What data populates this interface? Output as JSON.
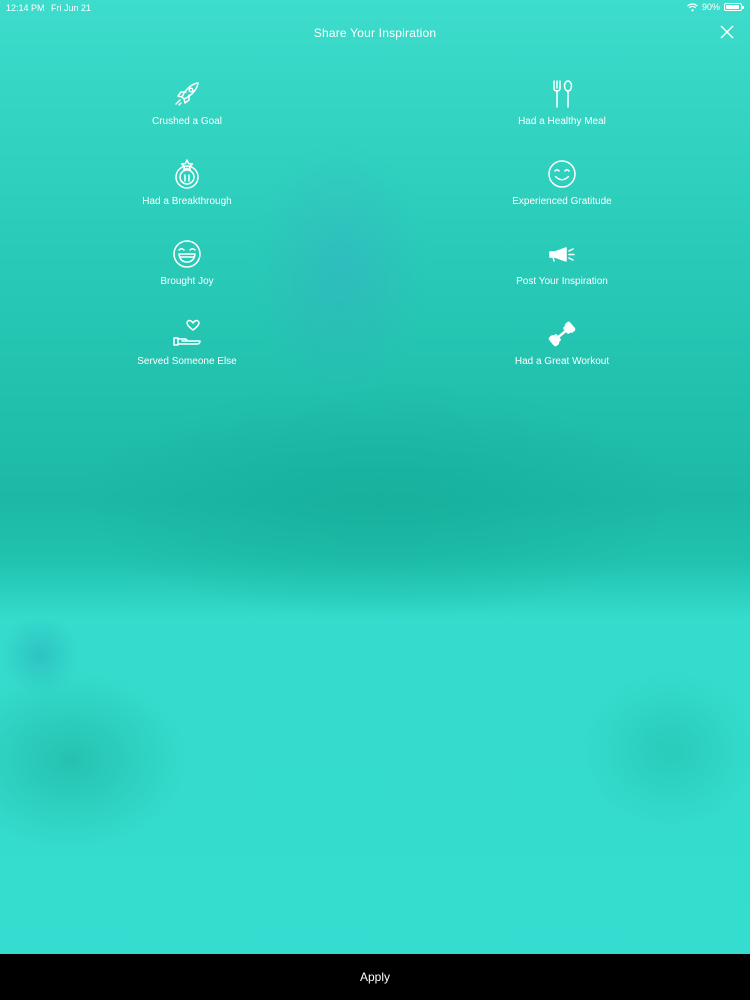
{
  "status_bar": {
    "time": "12:14 PM",
    "date": "Fri Jun 21",
    "battery": "90%",
    "battery_level": 0.9
  },
  "header": {
    "title": "Share Your Inspiration",
    "close_icon": "close-icon"
  },
  "inspirations": [
    {
      "label": "Crushed a Goal",
      "icon": "rocket-icon"
    },
    {
      "label": "Had a Healthy Meal",
      "icon": "fork-spoon-icon"
    },
    {
      "label": "Had a Breakthrough",
      "icon": "breakthrough-icon"
    },
    {
      "label": "Experienced Gratitude",
      "icon": "smile-icon"
    },
    {
      "label": "Brought Joy",
      "icon": "laughing-face-icon"
    },
    {
      "label": "Post Your Inspiration",
      "icon": "megaphone-icon"
    },
    {
      "label": "Served Someone Else",
      "icon": "hand-heart-icon"
    },
    {
      "label": "Had a Great Workout",
      "icon": "dumbbell-icon"
    }
  ],
  "footer": {
    "apply_label": "Apply"
  },
  "colors": {
    "background": "#33ddcc",
    "bottom_bar": "#000000",
    "text": "#ffffff"
  }
}
